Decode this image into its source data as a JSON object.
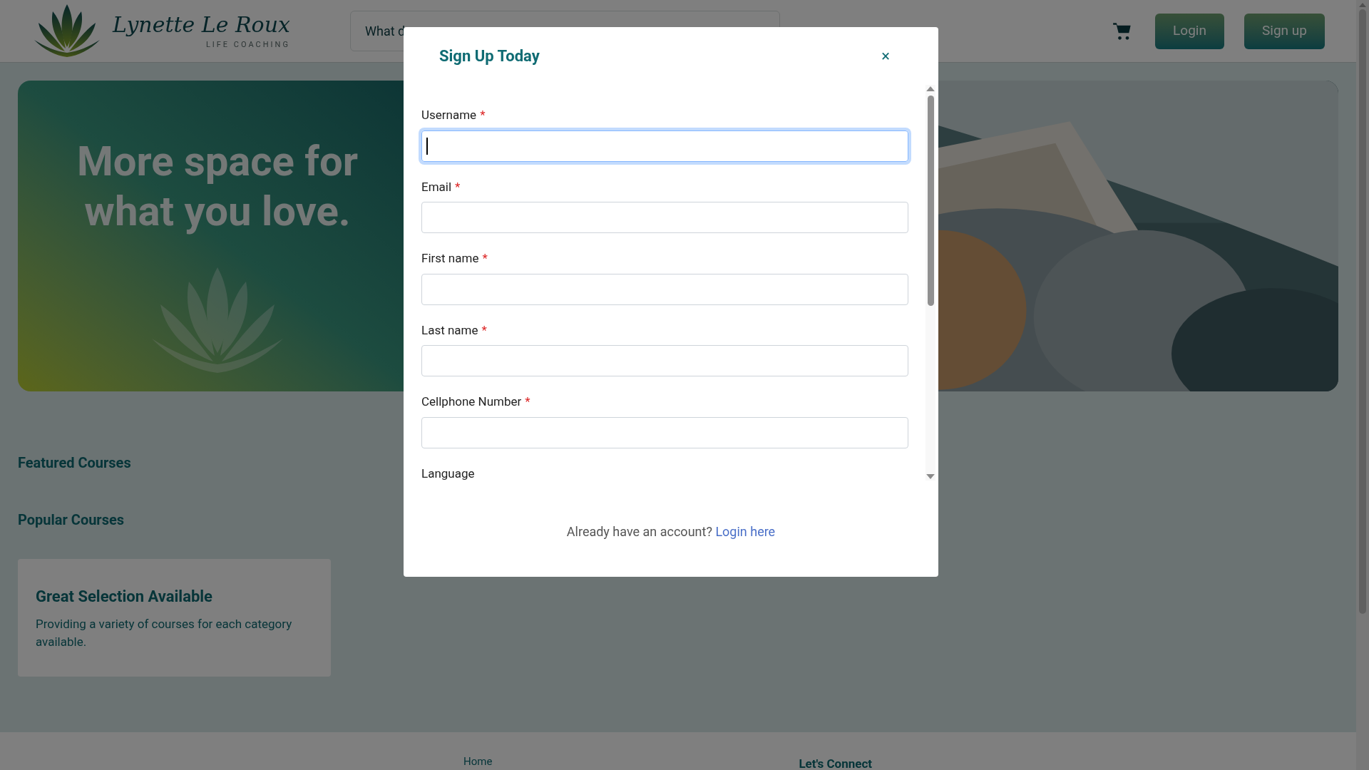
{
  "header": {
    "logo": {
      "name": "Lynette Le Roux",
      "tagline": "LIFE COACHING"
    },
    "search": {
      "placeholder": "What d"
    },
    "buttons": [
      "Login",
      "Sign up"
    ]
  },
  "hero": {
    "headline_lines": [
      "More space for",
      "what you love."
    ]
  },
  "sections": [
    "Featured Courses",
    "Popular Courses"
  ],
  "feature_card": {
    "title": "Great Selection Available",
    "text": "Providing a variety of courses for each category available."
  },
  "footer": {
    "links": [
      "Home"
    ],
    "heading": "Let's Connect"
  },
  "modal": {
    "title": "Sign Up Today",
    "close": "×",
    "fields": [
      {
        "label": "Username",
        "required": true,
        "focused": true
      },
      {
        "label": "Email",
        "required": true,
        "focused": false
      },
      {
        "label": "First name",
        "required": true,
        "focused": false
      },
      {
        "label": "Last name",
        "required": true,
        "focused": false
      },
      {
        "label": "Cellphone Number",
        "required": true,
        "focused": false
      }
    ],
    "required_mark": "*",
    "trailing_label": "Language",
    "footer_text": "Already have an account?",
    "footer_link": "Login here"
  }
}
